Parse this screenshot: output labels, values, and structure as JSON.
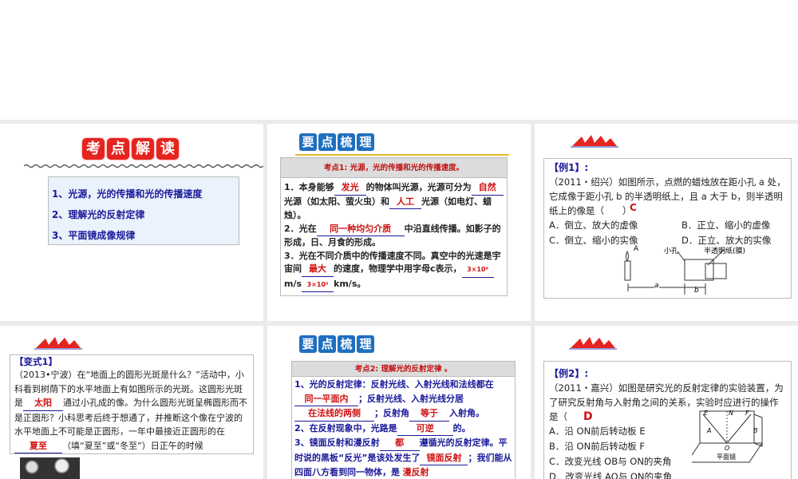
{
  "slide1": {
    "title_chars": [
      "考",
      "点",
      "解",
      "读"
    ],
    "items": [
      "1、光源，光的传播和光的传播速度",
      "2、理解光的反射定律",
      "3、平面镜成像规律"
    ]
  },
  "slide2": {
    "title_chars": [
      "要",
      "点",
      "梳",
      "理"
    ],
    "header": "考点1: 光源，光的传播和光的传播速度。",
    "l1a": "1．本身能够",
    "a1": "发光",
    "l1b": "的物体叫光源，光源可分为",
    "a2": "自然",
    "l1c": "光源（如太阳、萤火虫）和",
    "a3": "人工",
    "l1d": "光源（如电灯、蜡烛）。",
    "l2a": "2．光在",
    "a4": "同一种均匀介质",
    "l2b": "中沿直线传播。如影子的形成，日、月食的形成。",
    "l3a": "3．光在不同介质中的传播速度不同。真空中的光速是宇宙间",
    "a5": "最大",
    "l3b": "的速度，物理学中用字母",
    "l3c": "c表示，",
    "a6": "3×10⁸",
    "l3d": "m/s",
    "a7": "3×10⁵",
    "l3e": "km/s。"
  },
  "slide3": {
    "label": "【例1】:",
    "q": "（2011・绍兴）如图所示，点燃的蜡烛放在距小孔 a 处，它成像于距小孔 b 的半透明纸上，且 a 大于 b，则半透明纸上的像是（　　）",
    "answer": "C",
    "opts": [
      "A．倒立、放大的虚像",
      "B．正立、缩小的虚像",
      "C．倒立、缩小的实像",
      "D．正立、放大的实像"
    ],
    "fig": {
      "candle": "A",
      "hole": "小孔",
      "paper": "半透明纸(膜)",
      "a": "a",
      "b": "b"
    }
  },
  "slide4": {
    "label": "【变式1】",
    "t1": "（2013•宁波）在“地面上的圆形光斑是什么？”活动中，小科看到树荫下的水平地面上有如图所示的光斑。这圆形光斑是",
    "a1": "太阳",
    "t2": "通过小孔成的像。为什么圆形光斑呈椭圆形而不是正圆形？小科思考后终于想通了，并推断这个像在宁波的水平地面上不可能是正圆形，一年中最接近正圆形的在",
    "a2": "夏至",
    "t3": "（填“夏至”或“冬至”）日正午的时候"
  },
  "slide5": {
    "title_chars": [
      "要",
      "点",
      "梳",
      "理"
    ],
    "header": "考点2: 理解光的反射定律 。",
    "t1": "1、光的反射定律：反射光线、入射光线和法线都在",
    "a1": "同一平面内",
    "t2": "；反射光线、入射光线分居",
    "a2": "在法线的两侧",
    "t3": "；反射角",
    "a3": "等于",
    "t4": "入射角。",
    "t5": "2、在反射现象中，光路是",
    "a4": "可逆",
    "t6": "的。",
    "t7": "3、镜面反射和漫反射",
    "a5": "都",
    "t8": "遵循光的反射定律。平时说的黑板“反光”是该处发生了",
    "a6": "镜面反射",
    "t9": "；我们能从四面八方看到同一物体，是",
    "a7": "漫反射"
  },
  "slide6": {
    "label": "【例2】:",
    "q": "（2011・嘉兴）如图是研究光的反射定律的实验装置，为了研究反射角与入射角之间的关系，实验时应进行的操作是（",
    "answer": "D",
    "opts": [
      "A．沿 ON前后转动板 E",
      "B．沿 ON前后转动板 F",
      "C．改变光线 OB与 ON的夹角",
      "D．改变光线 AO与 ON的夹角"
    ],
    "fig": {
      "E": "E",
      "N": "N",
      "F": "F",
      "A": "A",
      "B": "B",
      "O": "O",
      "mirror": "平面镜"
    }
  },
  "colors": {
    "red": "#e52420",
    "blue": "#1f6fc0",
    "navy": "#1a1a9a",
    "answer": "#d01010"
  }
}
